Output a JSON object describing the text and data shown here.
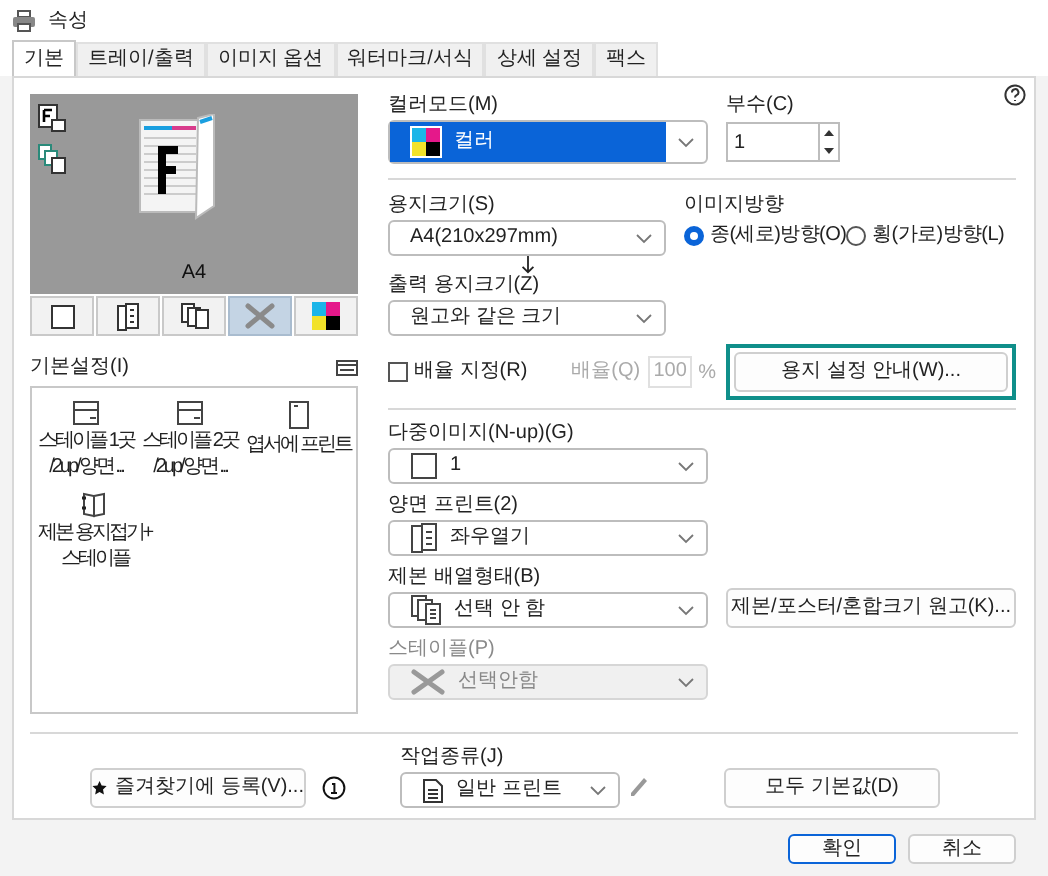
{
  "window": {
    "title": "속성"
  },
  "tabs": [
    {
      "label": "기본",
      "selected": true
    },
    {
      "label": "트레이/출력",
      "selected": false
    },
    {
      "label": "이미지 옵션",
      "selected": false
    },
    {
      "label": "워터마크/서식",
      "selected": false
    },
    {
      "label": "상세 설정",
      "selected": false
    },
    {
      "label": "팩스",
      "selected": false
    }
  ],
  "preview": {
    "paper": "A4"
  },
  "view_buttons": [
    {
      "kind": "single",
      "selected": false
    },
    {
      "kind": "duplex",
      "selected": false
    },
    {
      "kind": "booklet",
      "selected": false
    },
    {
      "kind": "staple",
      "selected": true
    },
    {
      "kind": "color",
      "selected": false
    }
  ],
  "presets": {
    "label": "기본설정(I)",
    "items": [
      {
        "kind": "staple",
        "lines": [
          "스테이플 1곳",
          "/2up/양면 ..."
        ]
      },
      {
        "kind": "staple",
        "lines": [
          "스테이플 2곳",
          "/2up/양면 ..."
        ]
      },
      {
        "kind": "postcard",
        "lines": [
          "엽서에 프린트"
        ]
      },
      {
        "kind": "fold",
        "lines": [
          "제본 용지접기+",
          "스테이플"
        ]
      }
    ]
  },
  "color_mode": {
    "label": "컬러모드(M)",
    "value": "컬러"
  },
  "copies": {
    "label": "부수(C)",
    "value": "1"
  },
  "paper_size": {
    "label": "용지크기(S)",
    "value": "A4(210x297mm)"
  },
  "orientation": {
    "label": "이미지방향",
    "options": [
      {
        "label": "종(세로)방향(O)",
        "selected": true
      },
      {
        "label": "횡(가로)방향(L)",
        "selected": false
      }
    ]
  },
  "output_size": {
    "label": "출력 용지크기(Z)",
    "value": "원고와 같은 크기"
  },
  "scale": {
    "label": "배율 지정(R)",
    "checked": false,
    "ratio_label": "배율(Q)",
    "ratio_value": "100",
    "unit": "%",
    "disabled": true
  },
  "paper_guide_button": "용지 설정 안내(W)...",
  "nup": {
    "label": "다중이미지(N-up)(G)",
    "value": "1"
  },
  "duplex": {
    "label": "양면 프린트(2)",
    "value": "좌우열기"
  },
  "binding": {
    "label": "제본 배열형태(B)",
    "value": "선택 안 함"
  },
  "booklet_button": "제본/포스터/혼합크기 원고(K)...",
  "staple": {
    "label": "스테이플(P)",
    "value": "선택안함",
    "disabled": true
  },
  "favorite_button": "즐겨찾기에 등록(V)...",
  "job_type": {
    "label": "작업종류(J)",
    "value": "일반 프린트"
  },
  "defaults_button": "모두 기본값(D)",
  "buttons": [
    "확인",
    "취소"
  ]
}
